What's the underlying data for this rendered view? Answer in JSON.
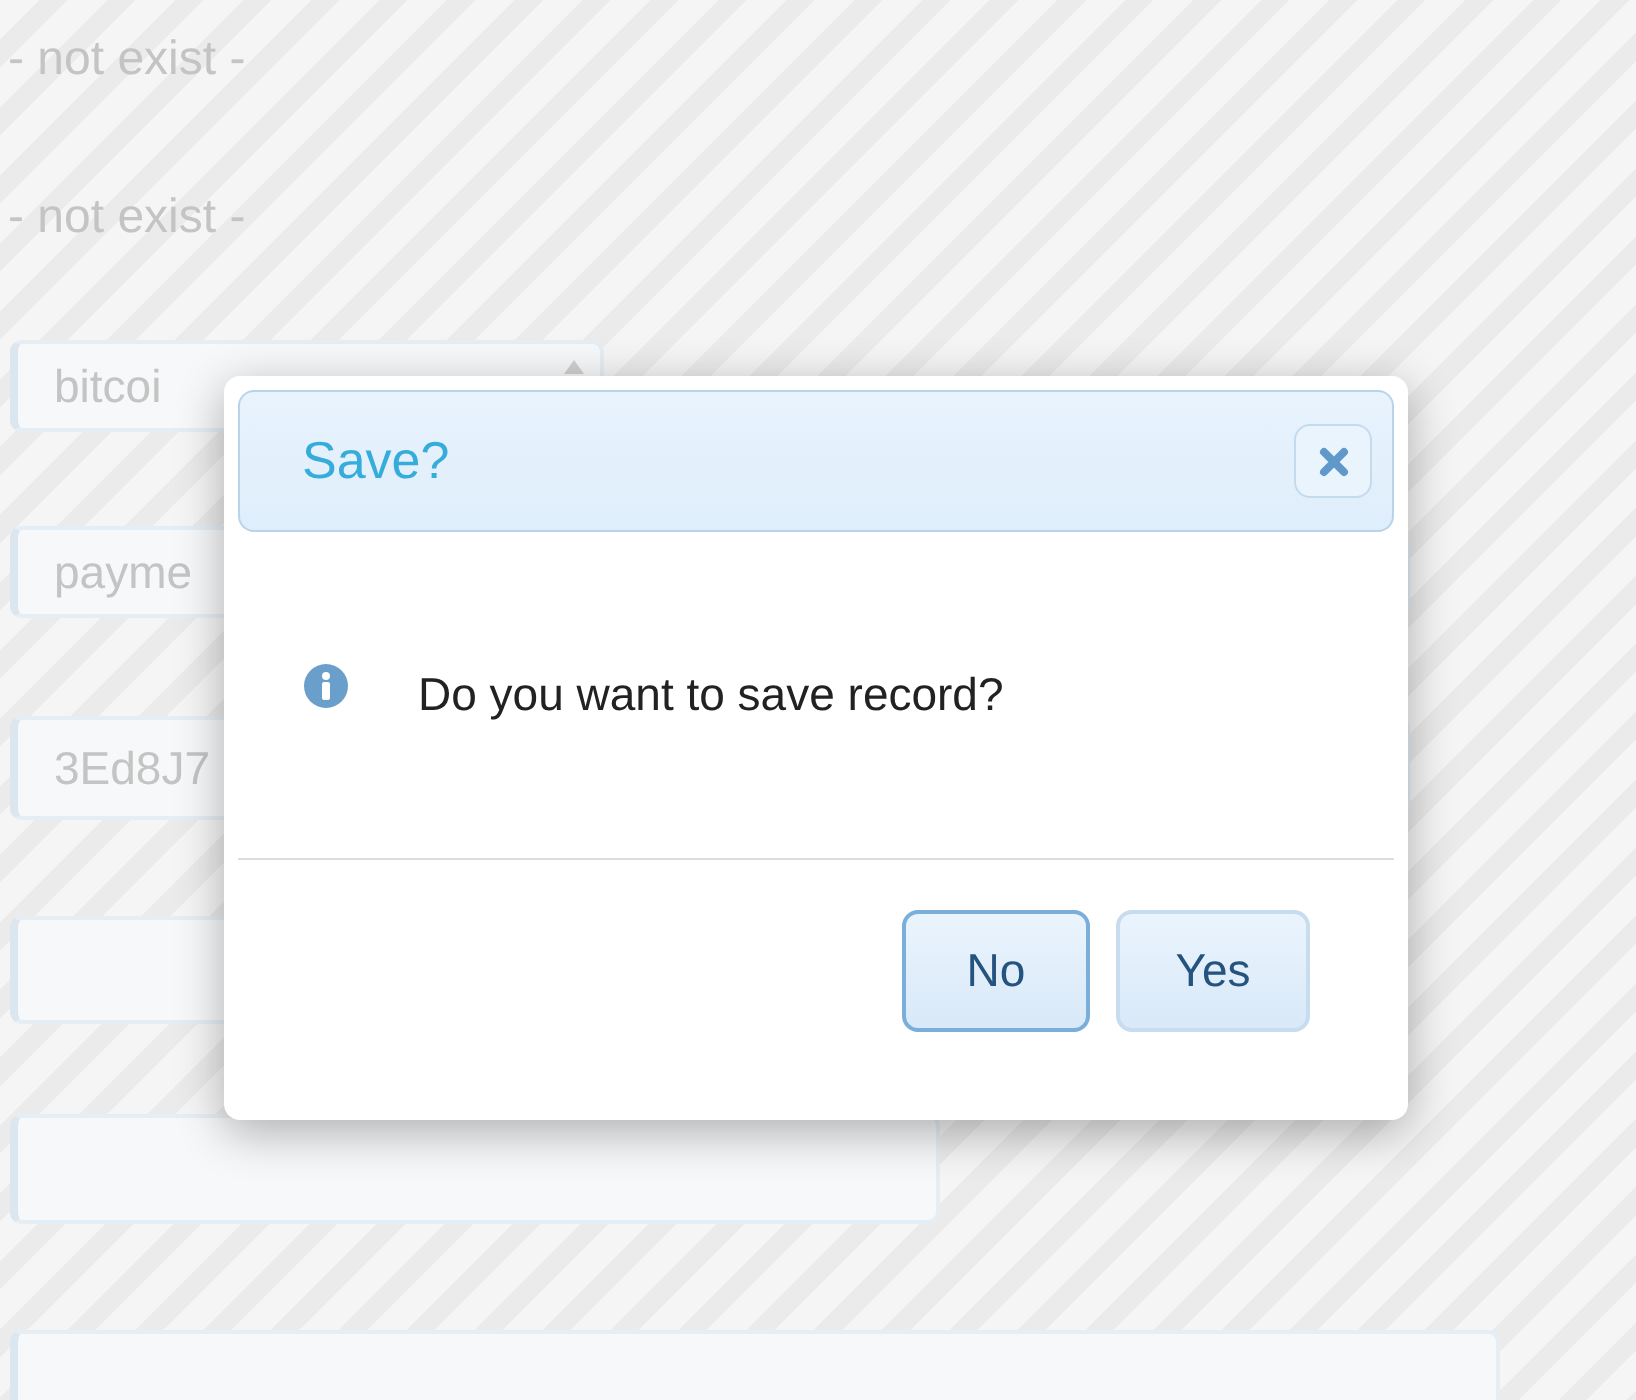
{
  "background_form": {
    "labels": [
      "- not exist -",
      "- not exist -"
    ],
    "fields": [
      {
        "kind": "select",
        "value": "bitcoi"
      },
      {
        "kind": "text",
        "value": "payme"
      },
      {
        "kind": "text",
        "value": "3Ed8J7"
      },
      {
        "kind": "text"
      },
      {
        "kind": "text"
      },
      {
        "kind": "text"
      }
    ]
  },
  "dialog": {
    "title": "Save?",
    "message": "Do you want to save record?",
    "buttons": [
      "No",
      "Yes"
    ]
  }
}
